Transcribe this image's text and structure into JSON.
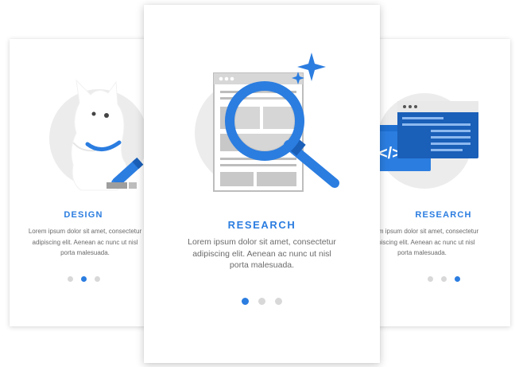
{
  "colors": {
    "accent": "#2b7de0",
    "text": "#6b6b6b",
    "dot_inactive": "#d8d8d8",
    "illustration_bg": "#ececec"
  },
  "cards": [
    {
      "id": "left",
      "title": "DESIGN",
      "description": [
        "Lorem ipsum dolor sit amet, consectetur",
        "adipiscing elit. Aenean ac nunc ut nisl",
        "porta malesuada."
      ],
      "illustration": "dog-pencil-icon",
      "dots_total": 3,
      "active_dot": 2
    },
    {
      "id": "center",
      "title": "RESEARCH",
      "description": [
        "Lorem ipsum dolor sit amet, consectetur",
        "adipiscing elit. Aenean ac nunc ut nisl",
        "porta malesuada."
      ],
      "illustration": "magnifier-browser-icon",
      "dots_total": 3,
      "active_dot": 1
    },
    {
      "id": "right",
      "title": "RESEARCH",
      "description": [
        "Lorem ipsum dolor sit amet, consectetur",
        "adipiscing elit. Aenean ac nunc ut nisl",
        "porta malesuada."
      ],
      "illustration": "code-windows-icon",
      "dots_total": 3,
      "active_dot": 3
    }
  ]
}
